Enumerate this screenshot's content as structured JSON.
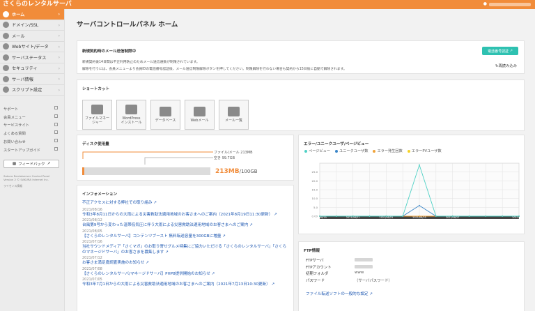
{
  "app": {
    "title": "さくらのレンタルサーバ"
  },
  "sidebar": {
    "items": [
      {
        "label": "ホーム",
        "active": true
      },
      {
        "label": "ドメイン/SSL"
      },
      {
        "label": "メール"
      },
      {
        "label": "Webサイト/データ"
      },
      {
        "label": "サーバステータス"
      },
      {
        "label": "セキュリティ"
      },
      {
        "label": "サーバ情報"
      },
      {
        "label": "スクリプト設定"
      }
    ],
    "links": [
      "サポート",
      "会員メニュー",
      "サービスサイト",
      "よくある質問",
      "お問い合わせ",
      "スタートアップガイド"
    ],
    "feedback_label": "フィードバック",
    "footer": [
      "Sakura Rentalserver Control Panel",
      "Version 2 © SAKURA Internet Inc.",
      "ライセンス情報"
    ]
  },
  "page": {
    "title": "サーバコントロールパネル ホーム"
  },
  "notice": {
    "title": "新規契約時のメール送信制限中",
    "lines": [
      "新規契約後14日間は不正利用防止のためメール送信通数が制限されています。",
      "解除を行うには、会員メニューより会員IDの電話番号認証後、メール送信制限解除ボタンを押してください。制限解除を行わない場合も契約から15日後に自動で解除されます。"
    ],
    "phone_button": "電話番号認証",
    "reload_label": "再読み込み"
  },
  "shortcuts": {
    "title": "ショートカット",
    "items": [
      {
        "label": "ファイルマネー\nジャー",
        "icon": "folder-icon"
      },
      {
        "label": "WordPress\nインストール",
        "icon": "wordpress-icon"
      },
      {
        "label": "データベース",
        "icon": "database-icon"
      },
      {
        "label": "Webメール",
        "icon": "mail-icon"
      },
      {
        "label": "メール一覧",
        "icon": "user-icon"
      }
    ]
  },
  "disk": {
    "title": "ディスク使用量",
    "file_mail_label": "ファイル/メール 213MB",
    "free_label": "空き 99.7GB",
    "used": "213MB",
    "total": "/100GB",
    "used_fraction": 0.0021
  },
  "info": {
    "title": "インフォメーション",
    "top_link": "不正アクセスに対する弊社での取り組み",
    "entries": [
      {
        "date": "2021/08/16",
        "text": "令和3年8月11日からの大雨による災害救助法適用地域のお客さまへのご案内（2021年8月19日11:30更新）"
      },
      {
        "date": "2021/08/12",
        "text": "台風第9号から変わった温帯低気圧に伴う大雨による災害救助法適用地域のお客さまへのご案内"
      },
      {
        "date": "2021/08/05",
        "text": "【さくらのレンタルサーバ】コンテンツブースト 無料転送容量を300GBに増量"
      },
      {
        "date": "2021/07/16",
        "text": "当社サウンドメディア「さくマガ」のお取り寄せグルメ特集にご協力いただける「さくらのレンタルサーバ」「さくらのマネージドサーバ」のお客さまを募集します"
      },
      {
        "date": "2021/07/12",
        "text": "お客さま満足度調査実施のお知らせ"
      },
      {
        "date": "2021/07/08",
        "text": "【さくらのレンタルサーバ/マネージドサーバ】PHP8提供開始のお知らせ"
      },
      {
        "date": "2021/07/05",
        "text": "令和3年7月1日からの大雨による災害救助法適用地域のお客さまへのご案内（2021年7月13日10:30更新）"
      }
    ]
  },
  "traffic": {
    "title": "エラー/ユニークユーザ/ページビュー",
    "legend": [
      {
        "name": "ページビュー",
        "color": "#4fd1c5"
      },
      {
        "name": "ユニークユーザ数",
        "color": "#3a86c8"
      },
      {
        "name": "エラー発生回数",
        "color": "#f0a33a"
      },
      {
        "name": "エラーPVユーザ数",
        "color": "#f5d327"
      }
    ]
  },
  "chart_data": {
    "type": "line",
    "title": "エラー/ユニークユーザ/ページビュー",
    "x": [
      "2021/08/19",
      "2021/08/20",
      "2021/08/21",
      "2021/08/22",
      "2021/08/23",
      "2021/08/24",
      "2021/08/25",
      "2021/08/26",
      "2021/08/27",
      "2021/08/28",
      "2021/08/29",
      "2021/08/30",
      "2021/09/01"
    ],
    "x_tick_labels": [
      "2021/08/19",
      "2021/08/21",
      "2021/08/23",
      "2021/08/25",
      "2021/08/27",
      "2021/09/01"
    ],
    "y_tick_labels": [
      "0.00",
      "5.0",
      "10.0",
      "15.0",
      "20.0",
      "25.0"
    ],
    "ylim": [
      0,
      30
    ],
    "series": [
      {
        "name": "ページビュー",
        "color": "#4fd1c5",
        "values": [
          0,
          0,
          0,
          0,
          0,
          0,
          29,
          0,
          0,
          0,
          0,
          0,
          0
        ]
      },
      {
        "name": "ユニークユーザ数",
        "color": "#3a86c8",
        "values": [
          0,
          0,
          0,
          0,
          0,
          0,
          6,
          0,
          0,
          0,
          0,
          0,
          0
        ]
      },
      {
        "name": "エラー発生回数",
        "color": "#f0a33a",
        "values": [
          0,
          0,
          0,
          0,
          0,
          0,
          0,
          0,
          0,
          0,
          0,
          0,
          0
        ]
      },
      {
        "name": "エラーPVユーザ数",
        "color": "#f5d327",
        "values": [
          0,
          0,
          0,
          0,
          0,
          0,
          0,
          0,
          0,
          0,
          0,
          0,
          0
        ]
      }
    ]
  },
  "ftp": {
    "title": "FTP情報",
    "rows": [
      {
        "key": "FTPサーバ",
        "value": ""
      },
      {
        "key": "FTPアカウント",
        "value": ""
      },
      {
        "key": "初期フォルダ",
        "value": "www"
      },
      {
        "key": "パスワード",
        "value": "（サーバパスワード）"
      }
    ],
    "guide_link": "ファイル転送ソフトの一般的な設定"
  },
  "colors": {
    "accent": "#f18c3a",
    "teal": "#2ec1b1",
    "link": "#1a55b0"
  }
}
